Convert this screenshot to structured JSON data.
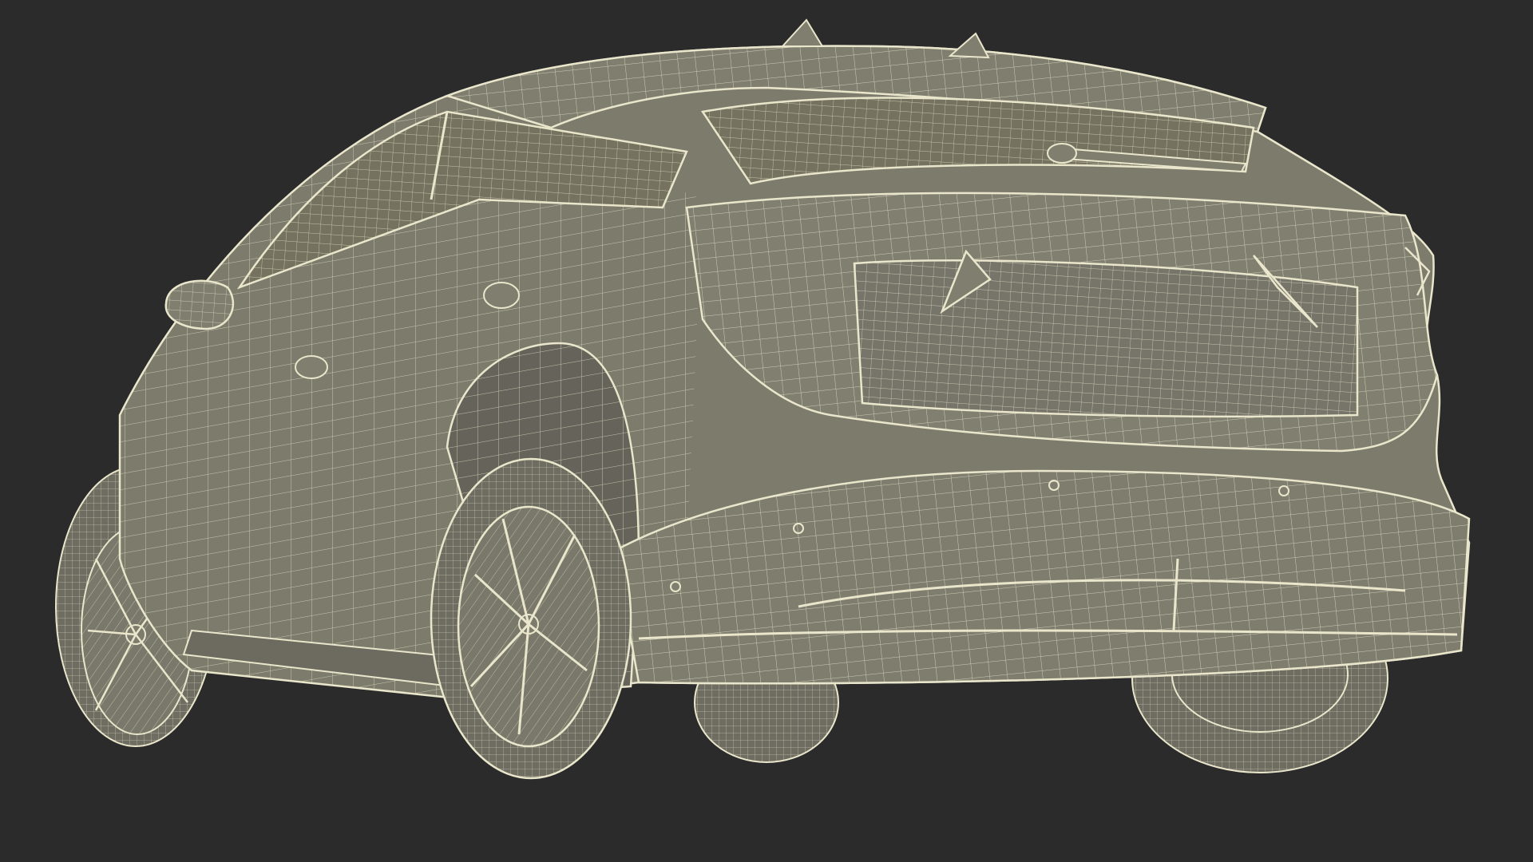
{
  "scene": {
    "subject": "suv-rear-three-quarter-wireframe",
    "background_color": "#2b2b2b",
    "surface_color": "#7d7b6c",
    "surface_shadow_color": "#66645a",
    "wire_color": "#e9e6cc",
    "tire_color": "#6f6d61"
  }
}
